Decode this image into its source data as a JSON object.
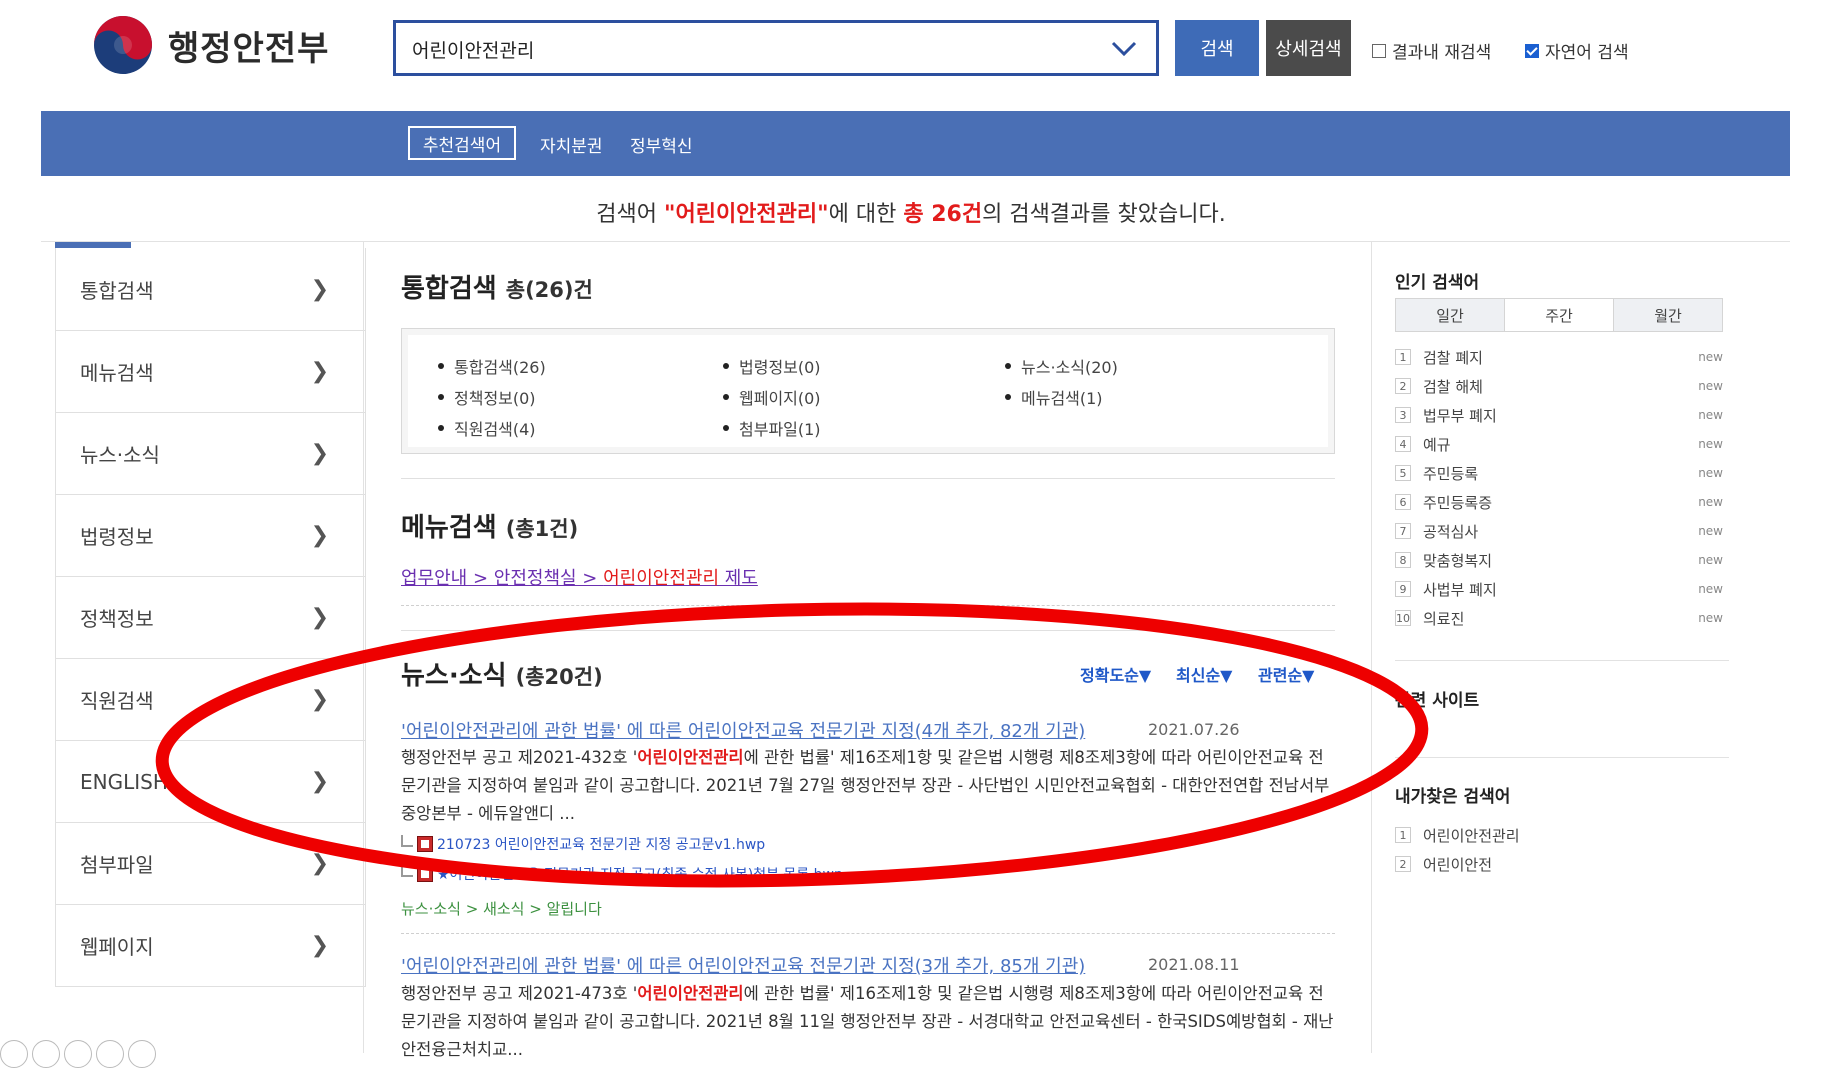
{
  "header": {
    "logo_text": "행정안전부",
    "search_value": "어린이안전관리",
    "search_button": "검색",
    "detail_button": "상세검색",
    "option_research": "결과내 재검색",
    "option_natural": "자연어 검색",
    "option_natural_checked": true
  },
  "topnav": {
    "items": [
      "추천검색어",
      "자치분권",
      "정부혁신"
    ]
  },
  "result_message": {
    "prefix": "검색어 ",
    "keyword": "\"어린이안전관리\"",
    "mid": "에 대한 ",
    "count": "총 26건",
    "suffix": "의 검색결과를 찾았습니다."
  },
  "leftnav": {
    "items": [
      {
        "label": "통합검색"
      },
      {
        "label": "메뉴검색"
      },
      {
        "label": "뉴스·소식"
      },
      {
        "label": "법령정보"
      },
      {
        "label": "정책정보"
      },
      {
        "label": "직원검색"
      },
      {
        "label": "ENGLISH"
      },
      {
        "label": "첨부파일"
      },
      {
        "label": "웹페이지"
      }
    ],
    "chevron": "❯"
  },
  "main": {
    "integrated": {
      "title": "통합검색",
      "count": "총(26)건",
      "summary": [
        "통합검색(26)",
        "법령정보(0)",
        "뉴스·소식(20)",
        "정책정보(0)",
        "웹페이지(0)",
        "메뉴검색(1)",
        "직원검색(4)",
        "첨부파일(1)"
      ]
    },
    "menu": {
      "title": "메뉴검색",
      "count": "(총1건)",
      "path_a": "업무안내 > 안전정책실 > ",
      "path_keyword": "어린이안전관리",
      "path_b": " 제도"
    },
    "news": {
      "title": "뉴스·소식",
      "count": "(총20건)",
      "sort": [
        "정확도순▼",
        "최신순▼",
        "관련순▼"
      ],
      "results": [
        {
          "title": "'어린이안전관리에 관한 법률' 에 따른 어린이안전교육 전문기관 지정(4개 추가, 82개 기관)",
          "date": "2021.07.26",
          "body_pre": "행정안전부 공고 제2021-432호 '",
          "body_kw": "어린이안전관리",
          "body_post": "에 관한 법률' 제16조제1항 및 같은법 시행령 제8조제3항에 따라 어린이안전교육 전문기관을 지정하여 붙임과 같이 공고합니다. 2021년 7월 27일 행정안전부 장관 - 사단법인 시민안전교육협회 - 대한안전연합 전남서부중앙본부 - 에듀알앤디 ...",
          "attachments": [
            "210723 어린이안전교육 전문기관 지정 공고문v1.hwp",
            "★어린이안전교육 전문기관 지정 공고(최종 수정 사본)첨부 목록.hwp"
          ],
          "path": "뉴스·소식 > 새소식 > 알립니다"
        },
        {
          "title": "'어린이안전관리에 관한 법률' 에 따른 어린이안전교육 전문기관 지정(3개 추가, 85개 기관)",
          "date": "2021.08.11",
          "body_pre": "행정안전부 공고 제2021-473호 '",
          "body_kw": "어린이안전관리",
          "body_post": "에 관한 법률' 제16조제1항 및 같은법 시행령 제8조제3항에 따라 어린이안전교육 전문기관을 지정하여 붙임과 같이 공고합니다. 2021년 8월 11일 행정안전부 장관 - 서경대학교 안전교육센터 - 한국SIDS예방협회 - 재난안전융근처치교..."
        }
      ]
    }
  },
  "right": {
    "popular_title": "인기 검색어",
    "tabs": [
      "일간",
      "주간",
      "월간"
    ],
    "popular": [
      {
        "rank": "1",
        "keyword": "검찰 폐지",
        "tag": "new"
      },
      {
        "rank": "2",
        "keyword": "검찰 해체",
        "tag": "new"
      },
      {
        "rank": "3",
        "keyword": "법무부 폐지",
        "tag": "new"
      },
      {
        "rank": "4",
        "keyword": "예규",
        "tag": "new"
      },
      {
        "rank": "5",
        "keyword": "주민등록",
        "tag": "new"
      },
      {
        "rank": "6",
        "keyword": "주민등록증",
        "tag": "new"
      },
      {
        "rank": "7",
        "keyword": "공적심사",
        "tag": "new"
      },
      {
        "rank": "8",
        "keyword": "맞춤형복지",
        "tag": "new"
      },
      {
        "rank": "9",
        "keyword": "사법부 폐지",
        "tag": "new"
      },
      {
        "rank": "10",
        "keyword": "의료진",
        "tag": "new"
      }
    ],
    "related_title": "관련 사이트",
    "my_title": "내가찾은 검색어",
    "my": [
      {
        "rank": "1",
        "keyword": "어린이안전관리"
      },
      {
        "rank": "2",
        "keyword": "어린이안전"
      }
    ]
  },
  "colors": {
    "brand_blue": "#4a6fb5",
    "highlight_red": "#e21b1b",
    "annotation_red": "#ee0000"
  }
}
